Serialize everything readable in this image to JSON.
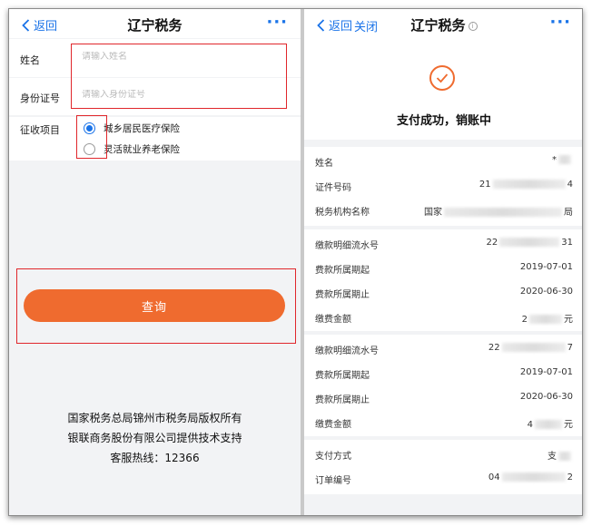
{
  "left": {
    "nav": {
      "back_label": "返回",
      "title": "辽宁税务",
      "more": "···"
    },
    "name_field": {
      "label": "姓名",
      "placeholder": "请输入姓名",
      "value": ""
    },
    "id_field": {
      "label": "身份证号",
      "placeholder": "请输入身份证号",
      "value": ""
    },
    "collection": {
      "label": "征收项目",
      "options": [
        {
          "label": "城乡居民医疗保险",
          "selected": true
        },
        {
          "label": "灵活就业养老保险",
          "selected": false
        }
      ]
    },
    "query_button": "查询",
    "footer": [
      "国家税务总局锦州市税务局版权所有",
      "银联商务股份有限公司提供技术支持",
      "客服热线：12366"
    ]
  },
  "right": {
    "nav": {
      "back_label": "返回",
      "close_label": "关闭",
      "title": "辽宁税务",
      "info": "i",
      "more": "···"
    },
    "status": "支付成功，销账中",
    "person": {
      "name": {
        "label": "姓名",
        "value": "*"
      },
      "id_no": {
        "label": "证件号码",
        "value_start": "21",
        "value_end": "4"
      },
      "tax_office": {
        "label": "税务机构名称",
        "value_start": "国家",
        "value_end": "局"
      }
    },
    "payments": [
      {
        "serial": {
          "label": "缴款明细流水号",
          "value_start": "22",
          "value_end": "31"
        },
        "start": {
          "label": "费款所属期起",
          "value": "2019-07-01"
        },
        "end": {
          "label": "费款所属期止",
          "value": "2020-06-30"
        },
        "amount": {
          "label": "缴费金额",
          "value_start": "2",
          "value_end": "元"
        }
      },
      {
        "serial": {
          "label": "缴款明细流水号",
          "value_start": "22",
          "value_end": "7"
        },
        "start": {
          "label": "费款所属期起",
          "value": "2019-07-01"
        },
        "end": {
          "label": "费款所属期止",
          "value": "2020-06-30"
        },
        "amount": {
          "label": "缴费金额",
          "value_start": "4",
          "value_end": "元"
        }
      }
    ],
    "order": {
      "method": {
        "label": "支付方式",
        "value": "支"
      },
      "order_no": {
        "label": "订单编号",
        "value_start": "04",
        "value_end": "2"
      }
    }
  },
  "colors": {
    "accent": "#1a73e8",
    "primary_button": "#ef6b2f",
    "highlight_box": "#e0262b"
  }
}
